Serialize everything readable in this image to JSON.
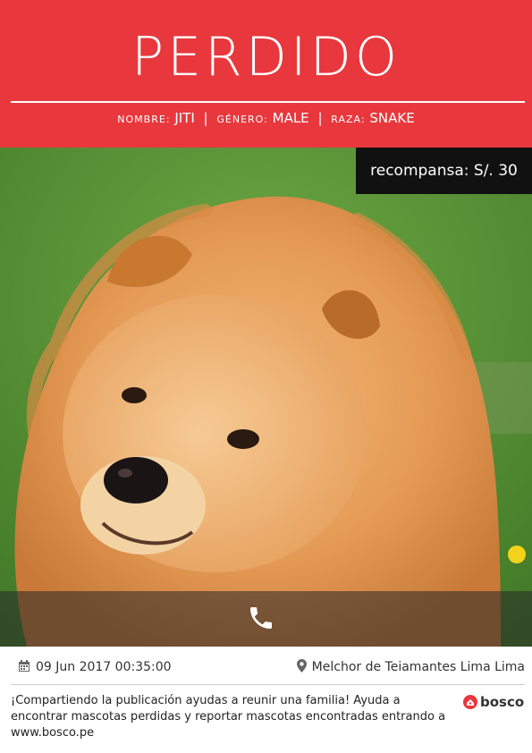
{
  "header": {
    "title": "PERDIDO",
    "name_label": "NOMBRE:",
    "name_value": "JITI",
    "gender_label": "GÉNERO:",
    "gender_value": "MALE",
    "breed_label": "RAZA:",
    "breed_value": "SNAKE",
    "separator": "|"
  },
  "reward": {
    "label": "recompansa:",
    "amount": "S/. 30"
  },
  "photo": {
    "subject": "chow chow dog"
  },
  "call": {
    "icon": "phone-icon"
  },
  "info": {
    "date": "09 Jun 2017 00:35:00",
    "date_icon": "calendar-icon",
    "location": "Melchor de Teiamantes Lima Lima",
    "location_icon": "map-pin-icon",
    "promo_text": "¡Compartiendo la publicación ayudas a reunir una familia! Ayuda a encontrar mascotas perdidas y reportar mascotas encontradas entrando a www.bosco.pe"
  },
  "brand": {
    "name": "bosco",
    "color": "#e8383d"
  },
  "colors": {
    "header": "#e8383d",
    "reward_bg": "#111111"
  }
}
